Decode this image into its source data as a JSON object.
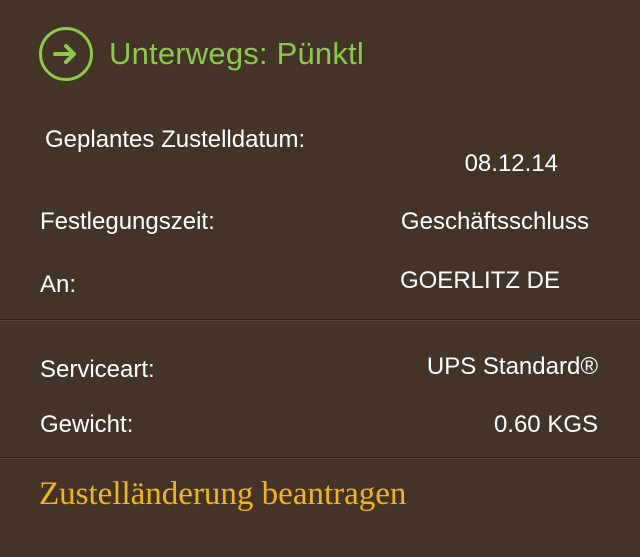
{
  "status": {
    "title": "Unterwegs: Pünktl",
    "icon": "arrow-right-circle-icon",
    "color": "#8dc74e"
  },
  "details": {
    "scheduled_label": "Geplantes Zustelldatum:",
    "scheduled_value": "08.12.14",
    "commit_label": "Festlegungszeit:",
    "commit_value": "Geschäftsschluss",
    "to_label": "An:",
    "to_value": "GOERLITZ DE"
  },
  "service": {
    "service_label": "Serviceart:",
    "service_value": "UPS Standard®",
    "weight_label": "Gewicht:",
    "weight_value": "0.60 KGS"
  },
  "action": {
    "label": "Zustelländerung beantragen",
    "color": "#f3b31c"
  },
  "colors": {
    "background": "#443428"
  }
}
